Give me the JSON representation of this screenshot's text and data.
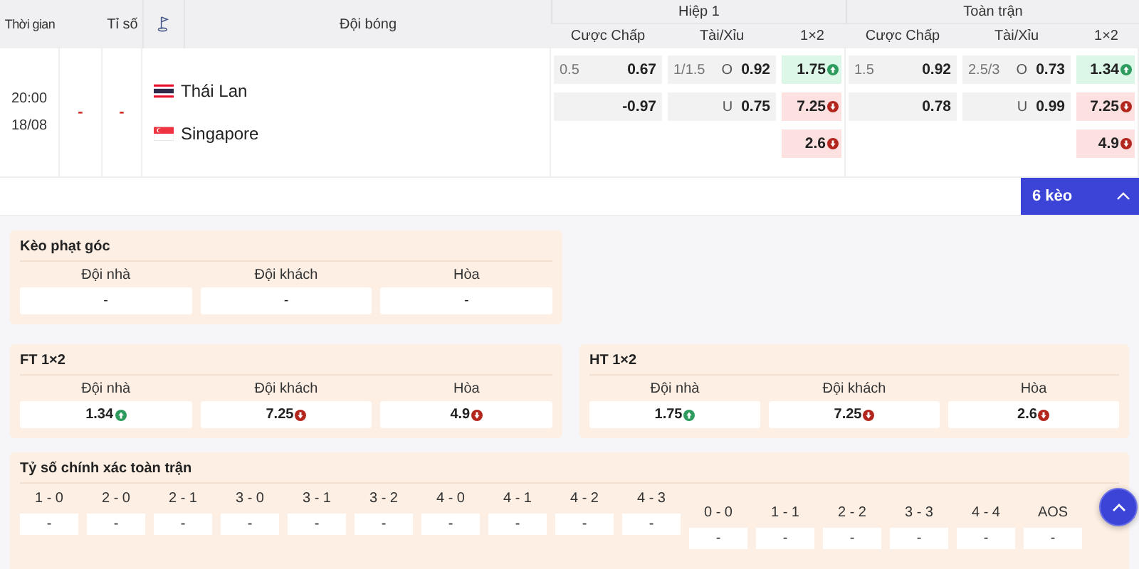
{
  "header": {
    "time": "Thời gian",
    "score": "Tỉ số",
    "team": "Đội bóng",
    "periods": [
      {
        "title": "Hiệp 1",
        "columns": [
          "Cược Chấp",
          "Tài/Xỉu",
          "1×2"
        ]
      },
      {
        "title": "Toàn trận",
        "columns": [
          "Cược Chấp",
          "Tài/Xỉu",
          "1×2"
        ]
      }
    ]
  },
  "match": {
    "time": "20:00",
    "date": "18/08",
    "score_home": "-",
    "score_away": "-",
    "teams": [
      {
        "name": "Thái Lan",
        "kind": "thailand"
      },
      {
        "name": "Singapore",
        "kind": "singapore"
      }
    ],
    "periods": [
      {
        "handicap": [
          {
            "line": "0.5",
            "odds": "0.67"
          },
          {
            "odds": "-0.97"
          }
        ],
        "overunder": [
          {
            "line": "1/1.5",
            "side": "O",
            "odds": "0.92"
          },
          {
            "side": "U",
            "odds": "0.75"
          }
        ],
        "x12": [
          {
            "odds": "1.75",
            "kind": "up"
          },
          {
            "odds": "7.25",
            "kind": "down"
          },
          {
            "odds": "2.6",
            "kind": "down"
          }
        ]
      },
      {
        "handicap": [
          {
            "line": "1.5",
            "odds": "0.92"
          },
          {
            "odds": "0.78"
          }
        ],
        "overunder": [
          {
            "line": "2.5/3",
            "side": "O",
            "odds": "0.73"
          },
          {
            "side": "U",
            "odds": "0.99"
          }
        ],
        "x12": [
          {
            "odds": "1.34",
            "kind": "up"
          },
          {
            "odds": "7.25",
            "kind": "down"
          },
          {
            "odds": "4.9",
            "kind": "down"
          }
        ]
      }
    ]
  },
  "more_button": {
    "label": "6 kèo",
    "expanded": true
  },
  "corner_panel": {
    "title": "Kèo phạt góc",
    "options": [
      {
        "label": "Đội nhà",
        "value": "-"
      },
      {
        "label": "Đội khách",
        "value": "-"
      },
      {
        "label": "Hòa",
        "value": "-"
      }
    ]
  },
  "result_panels": [
    {
      "title": "FT 1×2",
      "options": [
        {
          "label": "Đội nhà",
          "value": "1.34",
          "kind": "up"
        },
        {
          "label": "Đội khách",
          "value": "7.25",
          "kind": "down"
        },
        {
          "label": "Hòa",
          "value": "4.9",
          "kind": "down"
        }
      ]
    },
    {
      "title": "HT 1×2",
      "options": [
        {
          "label": "Đội nhà",
          "value": "1.75",
          "kind": "up"
        },
        {
          "label": "Đội khách",
          "value": "7.25",
          "kind": "down"
        },
        {
          "label": "Hòa",
          "value": "2.6",
          "kind": "down"
        }
      ]
    }
  ],
  "score_panel": {
    "title": "Tỷ số chính xác toàn trận",
    "scores": [
      {
        "label": "1 - 0",
        "value": "-"
      },
      {
        "label": "2 - 0",
        "value": "-"
      },
      {
        "label": "2 - 1",
        "value": "-"
      },
      {
        "label": "3 - 0",
        "value": "-"
      },
      {
        "label": "3 - 1",
        "value": "-"
      },
      {
        "label": "3 - 2",
        "value": "-"
      },
      {
        "label": "4 - 0",
        "value": "-"
      },
      {
        "label": "4 - 1",
        "value": "-"
      },
      {
        "label": "4 - 2",
        "value": "-"
      },
      {
        "label": "4 - 3",
        "value": "-"
      }
    ],
    "draw_scores": [
      {
        "label": "0 - 0",
        "value": "-"
      },
      {
        "label": "1 - 1",
        "value": "-"
      },
      {
        "label": "2 - 2",
        "value": "-"
      },
      {
        "label": "3 - 3",
        "value": "-"
      },
      {
        "label": "4 - 4",
        "value": "-"
      },
      {
        "label": "AOS",
        "value": "-"
      }
    ]
  }
}
